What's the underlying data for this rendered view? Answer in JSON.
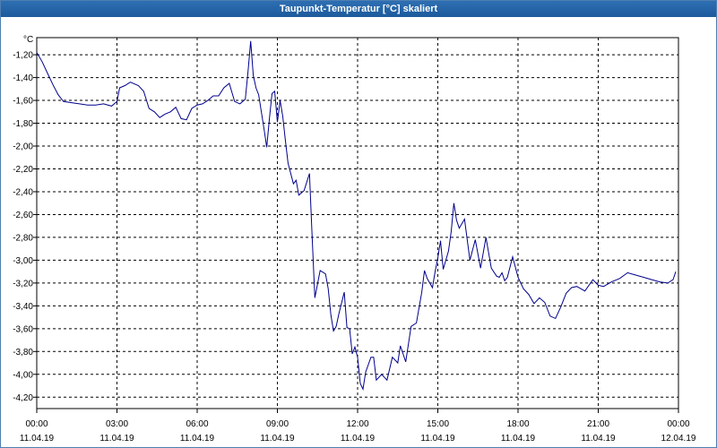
{
  "window": {
    "title": "Taupunkt-Temperatur [°C] skaliert"
  },
  "chart_data": {
    "type": "line",
    "title": "Taupunkt-Temperatur [°C] skaliert",
    "ylabel": "°C",
    "xlabel": "",
    "grid": true,
    "ylim": [
      -4.3,
      -1.05
    ],
    "xlim": [
      0,
      24
    ],
    "yticks": [
      "-1,20",
      "-1,40",
      "-1,60",
      "-1,80",
      "-2,00",
      "-2,20",
      "-2,40",
      "-2,60",
      "-2,80",
      "-3,00",
      "-3,20",
      "-3,40",
      "-3,60",
      "-3,80",
      "-4,00",
      "-4,20"
    ],
    "ytick_values": [
      -1.2,
      -1.4,
      -1.6,
      -1.8,
      -2.0,
      -2.2,
      -2.4,
      -2.6,
      -2.8,
      -3.0,
      -3.2,
      -3.4,
      -3.6,
      -3.8,
      -4.0,
      -4.2
    ],
    "xticks": [
      {
        "time": "00:00",
        "date": "11.04.19"
      },
      {
        "time": "03:00",
        "date": "11.04.19"
      },
      {
        "time": "06:00",
        "date": "11.04.19"
      },
      {
        "time": "09:00",
        "date": "11.04.19"
      },
      {
        "time": "12:00",
        "date": "11.04.19"
      },
      {
        "time": "15:00",
        "date": "11.04.19"
      },
      {
        "time": "18:00",
        "date": "11.04.19"
      },
      {
        "time": "21:00",
        "date": "11.04.19"
      },
      {
        "time": "00:00",
        "date": "12.04.19"
      }
    ],
    "line_color": "#00008b",
    "series": [
      {
        "x": [
          0,
          0.2,
          0.4,
          0.6,
          0.8,
          1.0,
          1.3,
          1.6,
          1.9,
          2.2,
          2.5,
          2.8,
          3.0,
          3.1,
          3.3,
          3.5,
          3.8,
          4.0,
          4.2,
          4.4,
          4.6,
          4.8,
          5.0,
          5.2,
          5.4,
          5.6,
          5.8,
          6.0,
          6.2,
          6.4,
          6.6,
          6.8,
          7.0,
          7.2,
          7.4,
          7.6,
          7.8,
          7.9,
          8.0,
          8.1,
          8.2,
          8.3,
          8.5,
          8.6,
          8.7,
          8.8,
          8.9,
          9.0,
          9.1,
          9.2,
          9.3,
          9.4,
          9.6,
          9.7,
          9.8,
          10.0,
          10.2,
          10.3,
          10.4,
          10.6,
          10.8,
          10.9,
          11.0,
          11.1,
          11.2,
          11.3,
          11.5,
          11.6,
          11.7,
          11.8,
          11.9,
          12.0,
          12.1,
          12.2,
          12.3,
          12.5,
          12.6,
          12.7,
          12.9,
          13.1,
          13.3,
          13.5,
          13.6,
          13.8,
          14.0,
          14.2,
          14.4,
          14.5,
          14.6,
          14.8,
          14.9,
          15.0,
          15.1,
          15.2,
          15.4,
          15.5,
          15.6,
          15.7,
          15.8,
          16.0,
          16.2,
          16.4,
          16.6,
          16.8,
          17.0,
          17.2,
          17.3,
          17.4,
          17.5,
          17.6,
          17.8,
          18.0,
          18.2,
          18.4,
          18.6,
          18.8,
          19.0,
          19.2,
          19.4,
          19.6,
          19.8,
          20.0,
          20.2,
          20.5,
          20.8,
          21.0,
          21.2,
          21.5,
          21.8,
          22.1,
          22.4,
          22.7,
          23.0,
          23.3,
          23.6,
          23.8,
          23.9
        ],
        "y": [
          -1.18,
          -1.26,
          -1.36,
          -1.46,
          -1.55,
          -1.61,
          -1.62,
          -1.63,
          -1.64,
          -1.64,
          -1.63,
          -1.65,
          -1.61,
          -1.49,
          -1.47,
          -1.44,
          -1.47,
          -1.52,
          -1.67,
          -1.7,
          -1.75,
          -1.72,
          -1.7,
          -1.66,
          -1.76,
          -1.77,
          -1.67,
          -1.64,
          -1.63,
          -1.6,
          -1.56,
          -1.56,
          -1.49,
          -1.45,
          -1.61,
          -1.63,
          -1.59,
          -1.35,
          -1.08,
          -1.38,
          -1.49,
          -1.55,
          -1.85,
          -2.01,
          -1.76,
          -1.54,
          -1.52,
          -1.79,
          -1.6,
          -1.74,
          -1.95,
          -2.15,
          -2.33,
          -2.3,
          -2.43,
          -2.39,
          -2.24,
          -2.8,
          -3.33,
          -3.09,
          -3.12,
          -3.25,
          -3.48,
          -3.62,
          -3.58,
          -3.47,
          -3.28,
          -3.59,
          -3.6,
          -3.82,
          -3.76,
          -3.85,
          -4.08,
          -4.13,
          -3.98,
          -3.85,
          -3.85,
          -4.05,
          -4.0,
          -4.05,
          -3.85,
          -3.9,
          -3.75,
          -3.89,
          -3.58,
          -3.55,
          -3.28,
          -3.09,
          -3.16,
          -3.24,
          -3.1,
          -2.98,
          -2.83,
          -3.08,
          -2.92,
          -2.75,
          -2.5,
          -2.65,
          -2.72,
          -2.64,
          -3.0,
          -2.82,
          -3.07,
          -2.8,
          -3.07,
          -3.14,
          -3.15,
          -3.11,
          -3.18,
          -3.15,
          -2.97,
          -3.15,
          -3.25,
          -3.3,
          -3.38,
          -3.33,
          -3.37,
          -3.49,
          -3.51,
          -3.41,
          -3.29,
          -3.24,
          -3.23,
          -3.27,
          -3.17,
          -3.22,
          -3.23,
          -3.19,
          -3.16,
          -3.11,
          -3.13,
          -3.15,
          -3.17,
          -3.19,
          -3.2,
          -3.17,
          -3.1
        ]
      }
    ]
  }
}
